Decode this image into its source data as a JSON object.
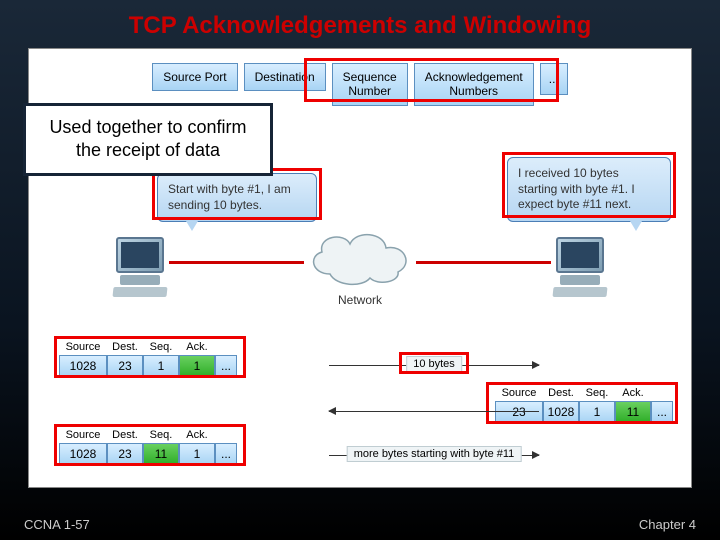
{
  "title": "TCP Acknowledgements and Windowing",
  "header_fields": {
    "source_port": "Source Port",
    "destination": "Destination",
    "sequence": "Sequence\nNumber",
    "acknowledgement": "Acknowledgement\nNumbers",
    "more": "..."
  },
  "callout": "Used together to confirm the receipt of data",
  "speech_left": "Start with byte #1, I am sending 10 bytes.",
  "speech_right": "I received 10 bytes starting with byte #1. I expect byte #11 next.",
  "network_label": "Network",
  "arrows": {
    "top_label": "10 bytes",
    "bottom_label": "more bytes starting with byte #11"
  },
  "labels": {
    "source": "Source",
    "dest": "Dest.",
    "seq": "Seq.",
    "ack": "Ack."
  },
  "seg1": {
    "source": "1028",
    "dest": "23",
    "seq": "1",
    "ack": "1",
    "more": "..."
  },
  "seg2": {
    "source": "23",
    "dest": "1028",
    "seq": "1",
    "ack": "11",
    "more": "..."
  },
  "seg3": {
    "source": "1028",
    "dest": "23",
    "seq": "11",
    "ack": "1",
    "more": "..."
  },
  "footer": {
    "left": "CCNA 1-57",
    "right": "Chapter 4"
  }
}
